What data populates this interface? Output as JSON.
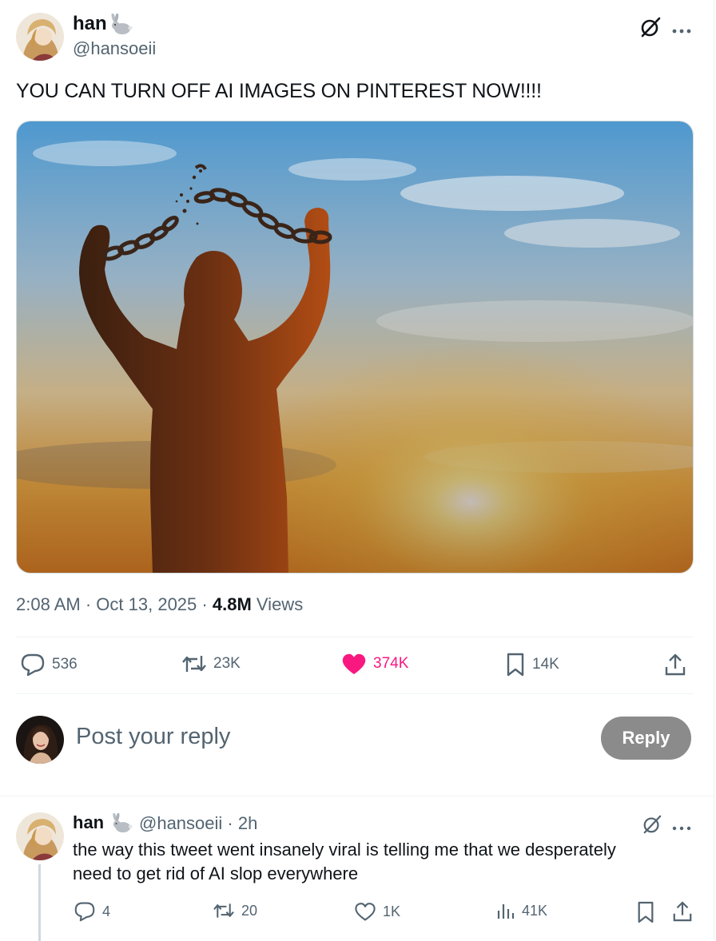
{
  "tweet": {
    "author_name": "han",
    "author_handle": "@hansoeii",
    "text": "YOU CAN TURN OFF AI IMAGES ON PINTEREST NOW!!!!",
    "time": "2:08 AM",
    "date": "Oct 13, 2025",
    "views_count": "4.8M",
    "views_label": "Views",
    "separator": "·",
    "actions": {
      "replies": "536",
      "reposts": "23K",
      "likes": "374K",
      "bookmarks": "14K"
    },
    "like_color": "#f91880"
  },
  "composer": {
    "placeholder": "Post your reply",
    "reply_button": "Reply"
  },
  "reply": {
    "author_name": "han",
    "author_handle": "@hansoeii",
    "separator": "·",
    "age": "2h",
    "text_line1": "the way this tweet went insanely viral is telling me that we desperately",
    "text_line2": "need to get rid of AI slop everywhere",
    "actions": {
      "replies": "4",
      "reposts": "20",
      "likes": "1K",
      "views": "41K"
    }
  },
  "icons": {
    "badge": "rabbit-icon",
    "grok": "grok-icon",
    "more": "more-icon",
    "reply": "reply-icon",
    "repost": "repost-icon",
    "like": "heart-icon",
    "bookmark": "bookmark-icon",
    "share": "share-icon",
    "views": "analytics-icon"
  }
}
